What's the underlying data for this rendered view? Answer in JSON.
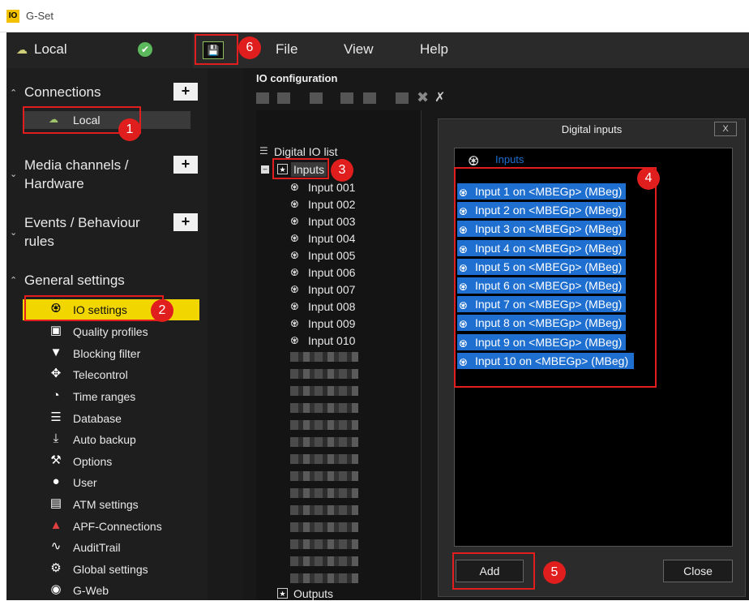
{
  "window": {
    "title": "G-Set",
    "logo": "IO"
  },
  "topbar": {
    "location": "Local",
    "menu": [
      "File",
      "View",
      "Help"
    ]
  },
  "sidebar": {
    "connections": {
      "title": "Connections",
      "item": "Local"
    },
    "media": {
      "title_line1": "Media channels /",
      "title_line2": "Hardware"
    },
    "events": {
      "title_line1": "Events / Behaviour",
      "title_line2": "rules"
    },
    "general": {
      "title": "General settings",
      "items": [
        {
          "label": "IO settings",
          "icon": "io-icon"
        },
        {
          "label": "Quality profiles",
          "icon": "star-box-icon"
        },
        {
          "label": "Blocking filter",
          "icon": "filter-icon"
        },
        {
          "label": "Telecontrol",
          "icon": "move-arrows-icon"
        },
        {
          "label": "Time ranges",
          "icon": "clock-icon"
        },
        {
          "label": "Database",
          "icon": "database-icon"
        },
        {
          "label": "Auto backup",
          "icon": "download-icon"
        },
        {
          "label": "Options",
          "icon": "wrench-icon"
        },
        {
          "label": "User",
          "icon": "user-icon"
        },
        {
          "label": "ATM settings",
          "icon": "atm-icon"
        },
        {
          "label": "APF-Connections",
          "icon": "apf-icon"
        },
        {
          "label": "AuditTrail",
          "icon": "audit-icon"
        },
        {
          "label": "Global settings",
          "icon": "global-settings-icon"
        },
        {
          "label": "G-Web",
          "icon": "globe-icon"
        }
      ]
    }
  },
  "io": {
    "title": "IO configuration",
    "root": "Digital IO list",
    "inputs": "Inputs",
    "outputs": "Outputs",
    "children": [
      "Input 001",
      "Input 002",
      "Input 003",
      "Input 004",
      "Input 005",
      "Input 006",
      "Input 007",
      "Input 008",
      "Input 009",
      "Input 010"
    ]
  },
  "dialog": {
    "title": "Digital inputs",
    "close_x": "X",
    "list_header": "Inputs",
    "items": [
      "Input 1 on <MBEGp> (MBeg)",
      "Input 2 on <MBEGp> (MBeg)",
      "Input 3 on <MBEGp> (MBeg)",
      "Input 4 on <MBEGp> (MBeg)",
      "Input 5 on <MBEGp> (MBeg)",
      "Input 6 on <MBEGp> (MBeg)",
      "Input 7 on <MBEGp> (MBeg)",
      "Input 8 on <MBEGp> (MBeg)",
      "Input 9 on <MBEGp> (MBeg)",
      "Input 10 on <MBEGp> (MBeg)"
    ],
    "add": "Add",
    "close": "Close"
  },
  "badges": [
    "1",
    "2",
    "3",
    "4",
    "5",
    "6"
  ],
  "colors": {
    "highlight": "#f2d600",
    "selection": "#1e6fd0",
    "annotation": "#e01e1e",
    "ok": "#5cb85c"
  }
}
